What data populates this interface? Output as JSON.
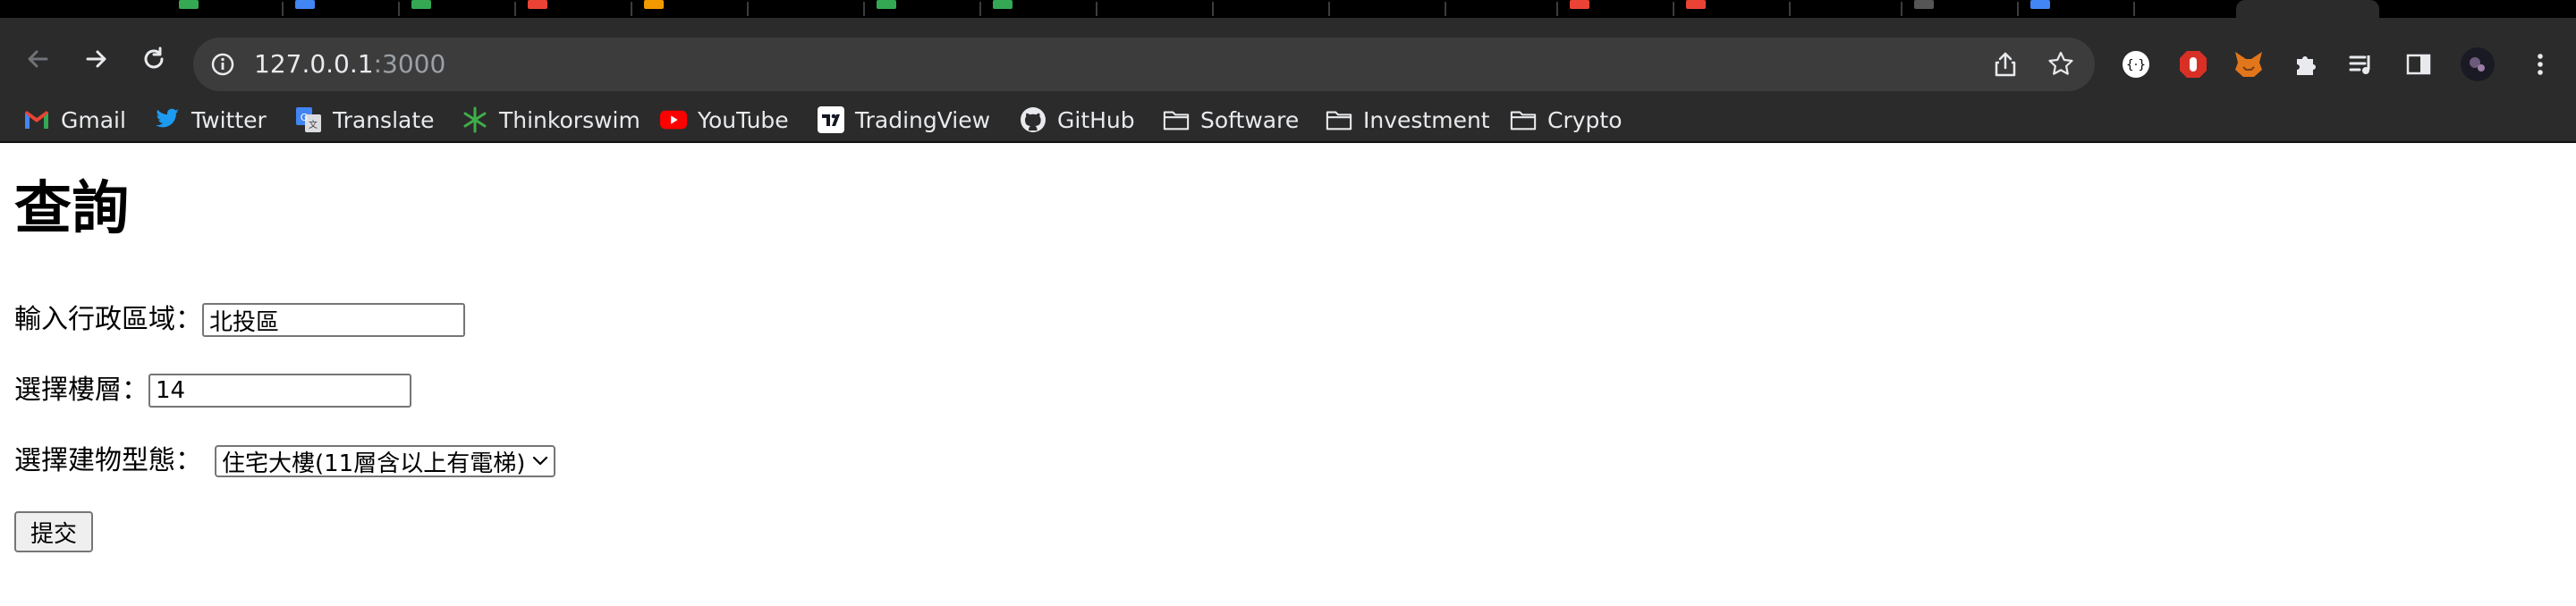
{
  "browser": {
    "url_host": "127.0.0.1",
    "url_port": ":3000",
    "bookmarks": [
      {
        "label": "Gmail",
        "icon": "gmail-icon"
      },
      {
        "label": "Twitter",
        "icon": "twitter-icon"
      },
      {
        "label": "Translate",
        "icon": "translate-icon"
      },
      {
        "label": "Thinkorswim",
        "icon": "thinkorswim-icon"
      },
      {
        "label": "YouTube",
        "icon": "youtube-icon"
      },
      {
        "label": "TradingView",
        "icon": "tradingview-icon"
      },
      {
        "label": "GitHub",
        "icon": "github-icon"
      },
      {
        "label": "Software",
        "icon": "folder-icon"
      },
      {
        "label": "Investment",
        "icon": "folder-icon"
      },
      {
        "label": "Crypto",
        "icon": "folder-icon"
      }
    ],
    "colors": {
      "chrome_bg": "#2b2b2b",
      "omnibox_bg": "#3c3c3c",
      "text": "#e8eaed"
    }
  },
  "page": {
    "heading": "查詢",
    "district_label": "輸入行政區域：",
    "district_value": "北投區",
    "floor_label": "選擇樓層：",
    "floor_value": "14",
    "building_type_label": "選擇建物型態：",
    "building_type_selected": "住宅大樓(11層含以上有電梯)",
    "submit_label": "提交"
  }
}
